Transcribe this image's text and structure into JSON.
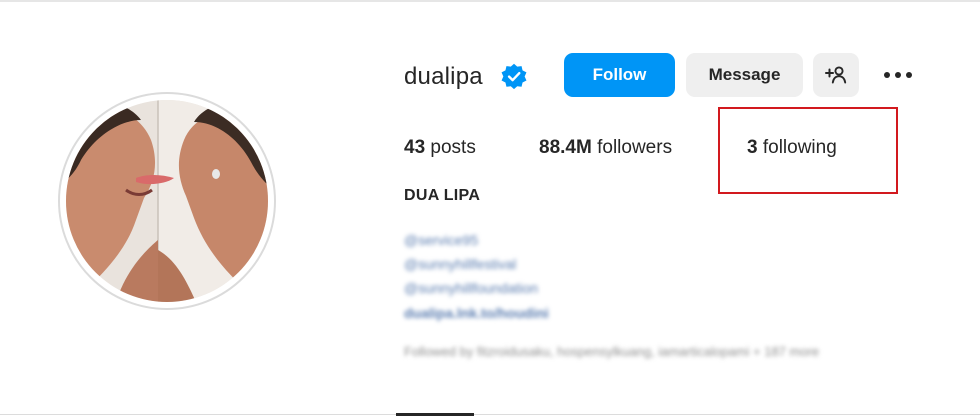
{
  "profile": {
    "username": "dualipa",
    "full_name": "DUA LIPA",
    "verified": true
  },
  "actions": {
    "follow_label": "Follow",
    "message_label": "Message",
    "add_user_icon": "add-user-icon",
    "more_icon": "more-options-icon"
  },
  "stats": {
    "posts_count": "43",
    "posts_label": "posts",
    "followers_count": "88.4M",
    "followers_label": "followers",
    "following_count": "3",
    "following_label": "following"
  },
  "bio_blurred": {
    "line1": "@service95",
    "line2": "@sunnyhillfestival",
    "line3": "@sunnyhillfoundation",
    "line4": "dualipa.lnk.to/houdini",
    "followed_by": "Followed by fitzroidusaku, hospensylkuang, iamarticalopami + 187 more"
  },
  "colors": {
    "accent": "#0095f6",
    "highlight": "#d2191e",
    "text": "#262626"
  }
}
